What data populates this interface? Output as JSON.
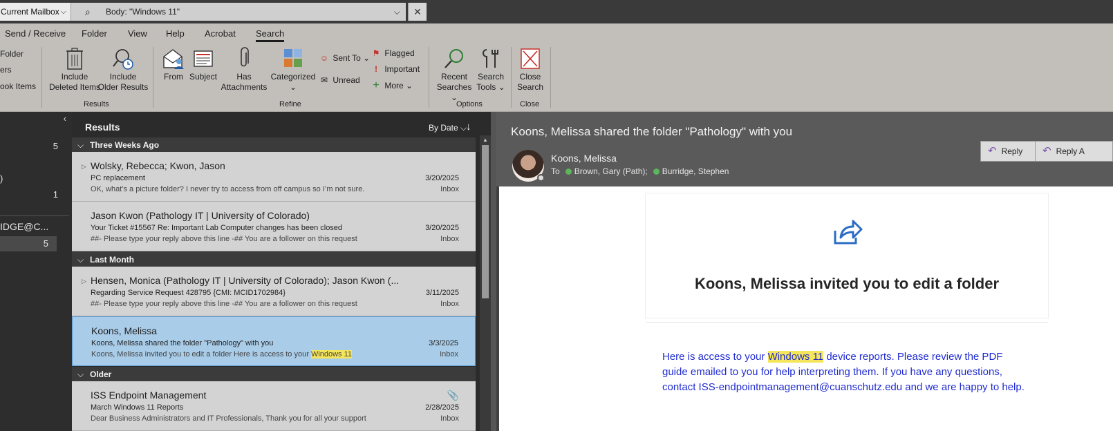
{
  "search": {
    "scope": "Current Mailbox",
    "query": "Body: \"Windows 11\""
  },
  "tabs": [
    "Send / Receive",
    "Folder",
    "View",
    "Help",
    "Acrobat",
    "Search"
  ],
  "ribbon": {
    "scope_partial": [
      "Folder",
      "ers",
      "ook Items"
    ],
    "results": {
      "include_deleted": [
        "Include",
        "Deleted Items"
      ],
      "include_older": [
        "Include",
        "Older Results"
      ],
      "group_label": "Results"
    },
    "refine": {
      "from": "From",
      "subject": "Subject",
      "has_attachments": [
        "Has",
        "Attachments"
      ],
      "categorized": "Categorized",
      "sent_to": "Sent To",
      "unread": "Unread",
      "flagged": "Flagged",
      "important": "Important",
      "more": "More",
      "group_label": "Refine"
    },
    "options": {
      "recent_searches": [
        "Recent",
        "Searches"
      ],
      "search_tools": [
        "Search",
        "Tools"
      ],
      "group_label": "Options"
    },
    "close": {
      "close_search": [
        "Close",
        "Search"
      ],
      "group_label": "Close"
    }
  },
  "nav": {
    "items": [
      {
        "label": "",
        "count": "5"
      },
      {
        "label": ")",
        "count": ""
      },
      {
        "label": "",
        "count": "1"
      },
      {
        "label": "IDGE@C...",
        "count": ""
      },
      {
        "label": "",
        "count": "5"
      }
    ]
  },
  "list": {
    "title": "Results",
    "sort": "By Date",
    "groups": [
      {
        "label": "Three Weeks Ago",
        "messages": [
          {
            "from": "Wolsky, Rebecca;  Kwon, Jason",
            "subject": "PC replacement",
            "preview": "OK, what’s a picture folder? I never try to access from off campus so I’m not sure.",
            "date": "3/20/2025",
            "folder": "Inbox"
          },
          {
            "from": "Jason Kwon (Pathology IT | University of Colorado)",
            "subject": "Your Ticket #15567 Re: Important Lab Computer changes has been closed",
            "preview": "##- Please type your reply above this line -##  You are a follower on this request",
            "date": "3/20/2025",
            "folder": "Inbox"
          }
        ]
      },
      {
        "label": "Last Month",
        "messages": [
          {
            "from": "Hensen, Monica (Pathology IT | University of Colorado);  Jason Kwon (...",
            "subject": "Regarding Service Request 428795 {CMI: MCID1702984}",
            "preview": "##- Please type your reply above this line -##  You are a follower on this request",
            "date": "3/11/2025",
            "folder": "Inbox"
          },
          {
            "from": "Koons, Melissa",
            "subject": "Koons, Melissa shared the folder \"Pathology\" with you",
            "preview_before": "Koons, Melissa invited you to edit a folder   Here is access to your ",
            "preview_hl": "Windows 11",
            "date": "3/3/2025",
            "folder": "Inbox"
          }
        ]
      },
      {
        "label": "Older",
        "messages": [
          {
            "from": "ISS Endpoint Management",
            "subject": "March Windows 11 Reports",
            "preview": "Dear Business Administrators and IT Professionals,  Thank you for all your support",
            "date": "2/28/2025",
            "folder": "Inbox"
          }
        ]
      }
    ]
  },
  "reader": {
    "subject": "Koons, Melissa shared the folder \"Pathology\" with you",
    "sender": "Koons, Melissa",
    "to_label": "To",
    "to_1": "Brown, Gary (Path);",
    "to_2": "Burridge, Stephen",
    "reply": "Reply",
    "reply_all": "Reply A",
    "card_title": "Koons, Melissa invited you to edit a folder",
    "body_before": "Here is access to your ",
    "body_hl": "Windows 11",
    "body_after": " device reports. Please review the PDF guide emailed to you for help interpreting them. If you have any questions, contact ISS-endpointmanagement@cuanschutz.edu and we are happy to help."
  },
  "colors": {
    "selected_row": "#a9cce8",
    "highlight": "#f5e55a",
    "body_link_text": "#1f2bd0",
    "reply_icon": "#7a4fa8"
  }
}
